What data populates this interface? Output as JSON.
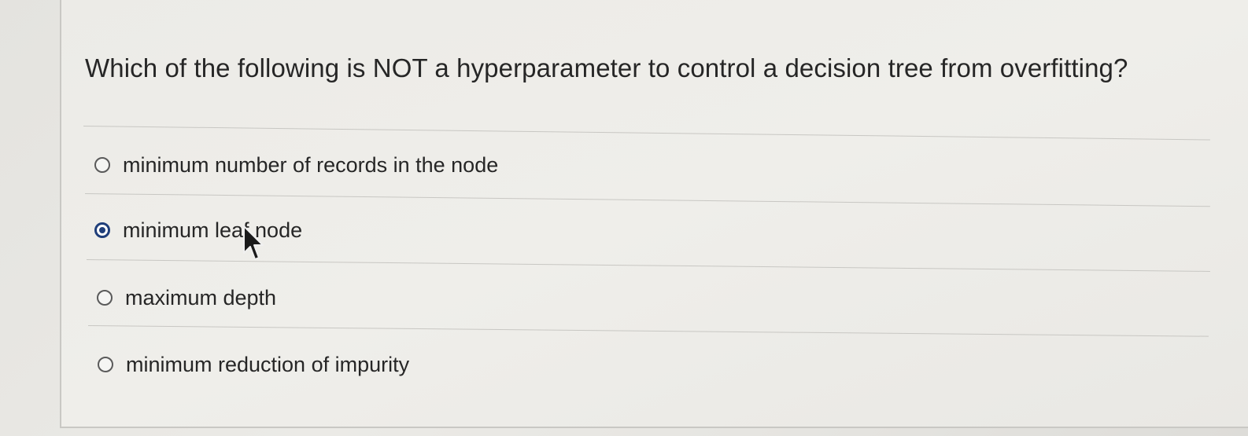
{
  "question": {
    "text": "Which of the following is NOT a hyperparameter to control a decision tree from overfitting?"
  },
  "answers": [
    {
      "label": "minimum number of records in the node",
      "selected": false
    },
    {
      "label": "minimum leaf node",
      "selected": true
    },
    {
      "label": "maximum depth",
      "selected": false
    },
    {
      "label": "minimum reduction of impurity",
      "selected": false
    }
  ],
  "cursor": {
    "icon": "mouse-pointer-icon"
  },
  "colors": {
    "selected_radio": "#1f3e7a",
    "text": "#262626",
    "background": "#ebeae6"
  }
}
